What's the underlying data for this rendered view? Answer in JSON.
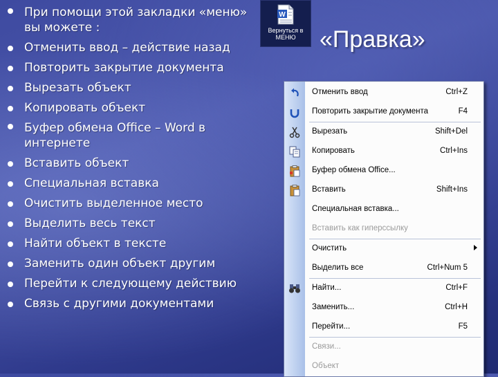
{
  "bullets": [
    "При помощи этой закладки «меню» вы можете :",
    "Отменить ввод – действие назад",
    "Повторить закрытие документа",
    "Вырезать объект",
    "Копировать объект",
    "Буфер обмена Office – Word в интернете",
    "Вставить объект",
    "Специальная вставка",
    "Очистить выделенное место",
    "Выделить весь текст",
    "Найти объект в тексте",
    "Заменить один объект другим",
    "Перейти к следующему действию",
    "Связь с другими документами"
  ],
  "back_button": {
    "label": "Вернуться в МЕНЮ",
    "icon": "word-document-icon"
  },
  "title": "«Правка»",
  "menu": {
    "items": [
      {
        "label": "Отменить ввод",
        "shortcut": "Ctrl+Z",
        "icon": "undo-icon"
      },
      {
        "label": "Повторить закрытие документа",
        "shortcut": "F4",
        "icon": "redo-icon"
      },
      {
        "label": "Вырезать",
        "shortcut": "Shift+Del",
        "icon": "scissors-icon"
      },
      {
        "label": "Копировать",
        "shortcut": "Ctrl+Ins",
        "icon": "copy-icon"
      },
      {
        "label": "Буфер обмена Office...",
        "shortcut": "",
        "icon": "clipboard-icon"
      },
      {
        "label": "Вставить",
        "shortcut": "Shift+Ins",
        "icon": "paste-icon"
      },
      {
        "label": "Специальная вставка...",
        "shortcut": ""
      },
      {
        "label": "Вставить как гиперссылку",
        "shortcut": "",
        "disabled": true
      },
      {
        "label": "Очистить",
        "shortcut": "",
        "submenu": true
      },
      {
        "label": "Выделить все",
        "shortcut": "Ctrl+Num 5"
      },
      {
        "label": "Найти...",
        "shortcut": "Ctrl+F",
        "icon": "binoculars-icon"
      },
      {
        "label": "Заменить...",
        "shortcut": "Ctrl+H"
      },
      {
        "label": "Перейти...",
        "shortcut": "F5"
      },
      {
        "label": "Связи...",
        "shortcut": "",
        "disabled": true
      },
      {
        "label": "Объект",
        "shortcut": "",
        "disabled": true
      }
    ]
  },
  "colors": {
    "background": "#3e4aa0",
    "text": "#ffffff",
    "menu_gutter": "#a9c0e8",
    "disabled_text": "#9a9a9a"
  }
}
